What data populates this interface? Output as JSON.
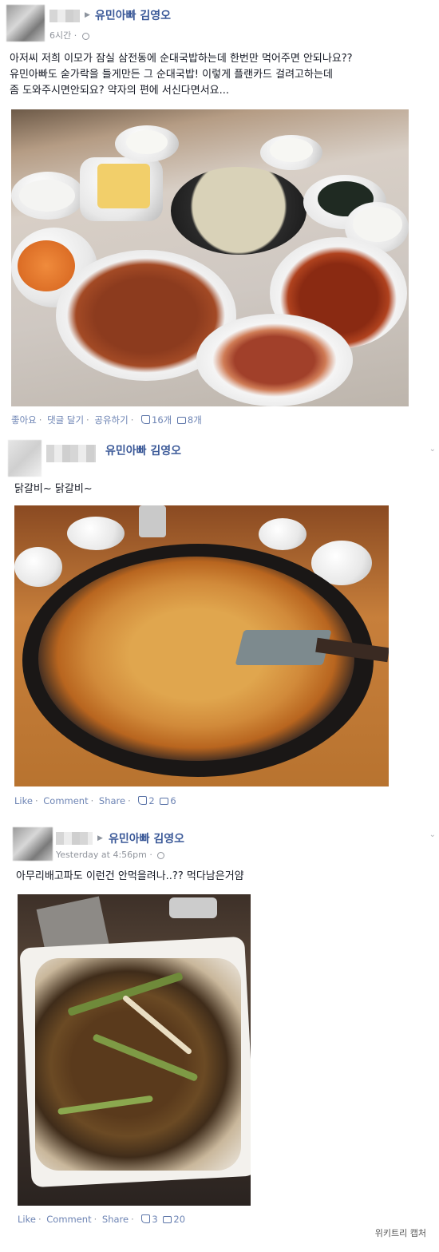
{
  "posts": [
    {
      "author": "유민아빠 김영오",
      "timestamp": "6시간",
      "text_lines": [
        "아저씨 저희 이모가 잠실 삼전동에 순대국밥하는데 한번만 먹어주면 안되나요??",
        "유민아빠도 숟가락을 들게만든 그 순대국밥! 이렇게 플랜카드 걸려고하는데",
        "좀 도와주시면안되요? 약자의 편에 서신다면서요..."
      ],
      "actions": {
        "like": "좋아요",
        "comment": "댓글 달기",
        "share": "공유하기"
      },
      "like_count": "16개",
      "comment_count": "8개"
    },
    {
      "author": "유민아빠 김영오",
      "text_lines": [
        "닭갈비~ 닭갈비~"
      ],
      "actions": {
        "like": "Like",
        "comment": "Comment",
        "share": "Share"
      },
      "like_count": "2",
      "comment_count": "6"
    },
    {
      "author": "유민아빠 김영오",
      "timestamp": "Yesterday at 4:56pm",
      "text_lines": [
        "아무리배고파도 이런건 안먹을려나..?? 먹다남은거얌"
      ],
      "actions": {
        "like": "Like",
        "comment": "Comment",
        "share": "Share"
      },
      "like_count": "3",
      "comment_count": "20"
    }
  ],
  "footer": "위키트리 캡처",
  "icons": {
    "arrow": "right-triangle-icon",
    "privacy": "globe-icon",
    "menu": "chevron-down-icon",
    "like": "thumbs-up-icon",
    "comment": "speech-bubble-icon"
  },
  "colors": {
    "author": "#3b5998",
    "link": "#6d84b4",
    "meta": "#90949c"
  }
}
